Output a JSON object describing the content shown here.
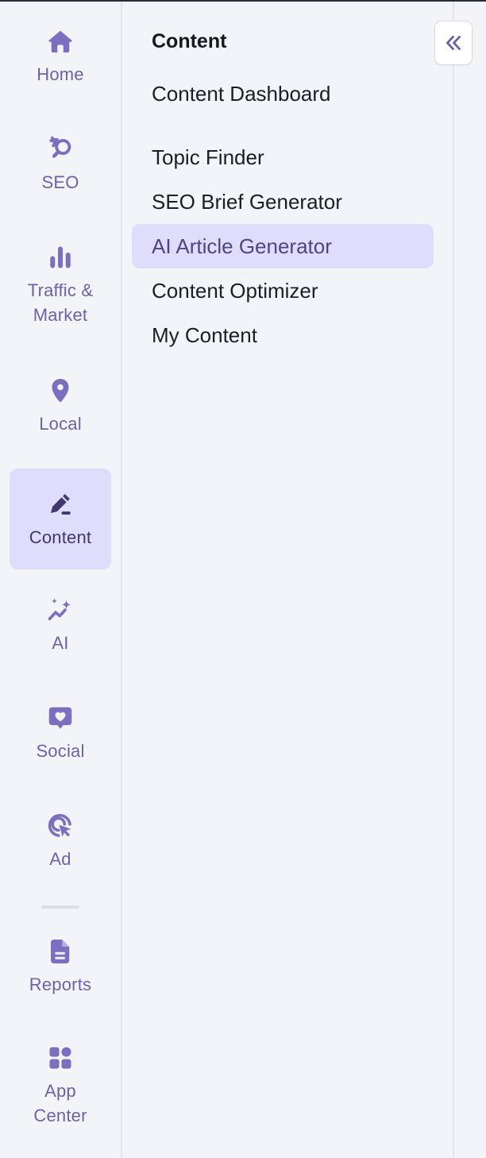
{
  "colors": {
    "accent": "#6d62a8",
    "active_bg": "#e0dcfb",
    "background": "#f3f4f8"
  },
  "rail": {
    "items": [
      {
        "label": "Home",
        "icon": "home-icon"
      },
      {
        "label": "SEO",
        "icon": "seo-icon"
      },
      {
        "label": "Traffic & Market",
        "icon": "bar-chart-icon"
      },
      {
        "label": "Local",
        "icon": "map-pin-icon"
      },
      {
        "label": "Content",
        "icon": "pencil-icon",
        "active": true
      },
      {
        "label": "AI",
        "icon": "sparkles-icon"
      },
      {
        "label": "Social",
        "icon": "heart-chat-icon"
      },
      {
        "label": "Ad",
        "icon": "cursor-target-icon"
      },
      {
        "label": "Reports",
        "icon": "document-icon"
      },
      {
        "label": "App Center",
        "icon": "apps-grid-icon"
      }
    ]
  },
  "panel": {
    "title": "Content",
    "items": [
      {
        "label": "Content Dashboard"
      },
      {
        "label": "Topic Finder"
      },
      {
        "label": "SEO Brief Generator"
      },
      {
        "label": "AI Article Generator",
        "active": true
      },
      {
        "label": "Content Optimizer"
      },
      {
        "label": "My Content"
      }
    ]
  },
  "collapse_button": {
    "icon": "double-chevron-left-icon"
  }
}
